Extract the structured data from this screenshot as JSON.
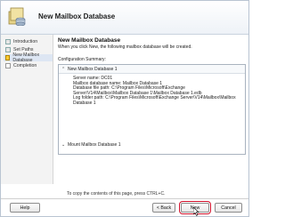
{
  "window": {
    "title": "New Mailbox Database"
  },
  "steps": [
    {
      "label": "Introduction",
      "state": "done"
    },
    {
      "label": "Set Paths",
      "state": "done"
    },
    {
      "label": "New Mailbox Database",
      "state": "current"
    },
    {
      "label": "Completion",
      "state": "future"
    }
  ],
  "content": {
    "title": "New Mailbox Database",
    "description": "When you click New, the following mailbox database will be created.",
    "summary_label": "Configuration Summary:",
    "summary_header": "New Mailbox Database 1",
    "details": [
      "Server name: DC01",
      "Mailbox database name: Mailbox Database 1",
      "Database file path: C:\\Program Files\\Microsoft\\Exchange",
      "Server\\V14\\Mailbox\\Mailbox Database 1\\Mailbox Database 1.edb",
      "Log folder path: C:\\Program Files\\Microsoft\\Exchange Server\\V14\\Mailbox\\Mailbox",
      "Database 1"
    ],
    "mount_item": "Mount Mailbox Database 1",
    "copy_hint": "To copy the contents of this page, press CTRL+C."
  },
  "buttons": {
    "help": "Help",
    "back": "< Back",
    "new": "New",
    "cancel": "Cancel"
  },
  "icons": {
    "title": "mailbox-database-icon",
    "collapse": "chevron-up-icon",
    "expand": "chevron-down-icon"
  }
}
